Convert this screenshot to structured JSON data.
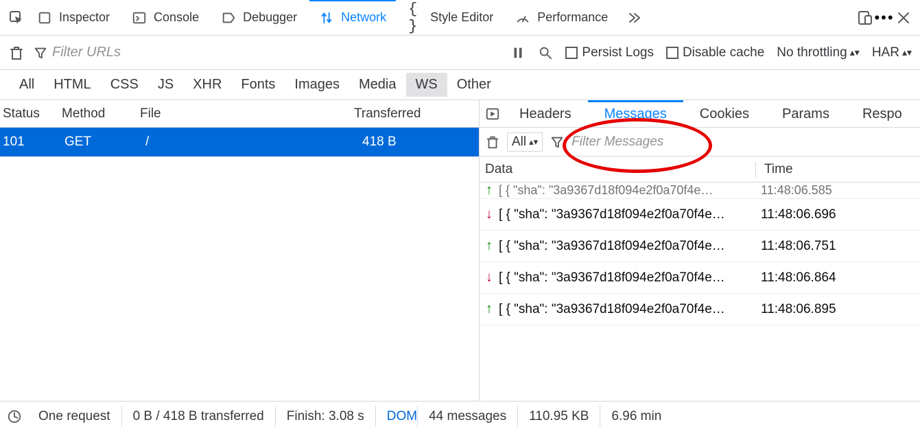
{
  "topTabs": {
    "inspector": "Inspector",
    "console": "Console",
    "debugger": "Debugger",
    "network": "Network",
    "styleEditor": "Style Editor",
    "performance": "Performance"
  },
  "secondary": {
    "filterPlaceholder": "Filter URLs",
    "persistLogs": "Persist Logs",
    "disableCache": "Disable cache",
    "throttling": "No throttling",
    "har": "HAR"
  },
  "typeRow": {
    "all": "All",
    "html": "HTML",
    "css": "CSS",
    "js": "JS",
    "xhr": "XHR",
    "fonts": "Fonts",
    "images": "Images",
    "media": "Media",
    "ws": "WS",
    "other": "Other"
  },
  "reqTable": {
    "headers": {
      "status": "Status",
      "method": "Method",
      "file": "File",
      "transferred": "Transferred"
    },
    "rows": [
      {
        "status": "101",
        "method": "GET",
        "file": "/",
        "transferred": "418 B"
      }
    ]
  },
  "detailTabs": {
    "headers": "Headers",
    "messages": "Messages",
    "cookies": "Cookies",
    "params": "Params",
    "response": "Respo"
  },
  "detailFilter": {
    "allSelector": "All",
    "placeholder": "Filter Messages"
  },
  "msgHead": {
    "data": "Data",
    "time": "Time"
  },
  "messages": [
    {
      "dir": "up",
      "data": "[ { \"sha\": \"3a9367d18f094e2f0a70f4e…",
      "time": "11:48:06.585",
      "cut": true
    },
    {
      "dir": "down",
      "data": "[ { \"sha\": \"3a9367d18f094e2f0a70f4e…",
      "time": "11:48:06.696"
    },
    {
      "dir": "up",
      "data": "[ { \"sha\": \"3a9367d18f094e2f0a70f4e…",
      "time": "11:48:06.751"
    },
    {
      "dir": "down",
      "data": "[ { \"sha\": \"3a9367d18f094e2f0a70f4e…",
      "time": "11:48:06.864"
    },
    {
      "dir": "up",
      "data": "[ { \"sha\": \"3a9367d18f094e2f0a70f4e…",
      "time": "11:48:06.895"
    }
  ],
  "statusbar": {
    "oneRequest": "One request",
    "transferred": "0 B / 418 B transferred",
    "finish": "Finish: 3.08 s",
    "dom": "DOM",
    "msgCount": "44 messages",
    "size": "110.95 KB",
    "duration": "6.96 min"
  }
}
